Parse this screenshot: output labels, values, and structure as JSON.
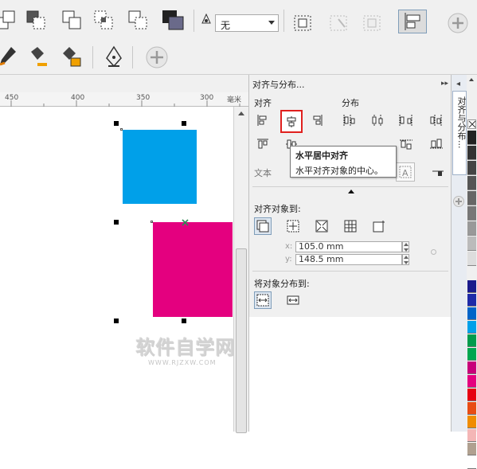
{
  "toolbar": {
    "font_option_value": "无",
    "add_label": "+"
  },
  "ruler": {
    "ticks": [
      "450",
      "400",
      "350",
      "300"
    ],
    "unit": "毫米"
  },
  "panel": {
    "title": "对齐与分布...",
    "align_label": "对齐",
    "distribute_label": "分布",
    "text_label": "文本",
    "align_to_label": "对齐对象到:",
    "distribute_to_label": "将对象分布到:",
    "x_prefix": "x:",
    "y_prefix": "y:",
    "x_value": "105.0 mm",
    "y_value": "148.5 mm"
  },
  "tooltip": {
    "title": "水平居中对齐",
    "description": "水平对齐对象的中心。"
  },
  "side_tab": {
    "label": "对齐与分布..."
  },
  "watermark": {
    "text": "软件自学网",
    "url": "WWW.RJZXW.COM"
  },
  "colors": {
    "blue_square": "#00a0e9",
    "magenta_square": "#e4007f",
    "highlight_border": "#e0201e",
    "palette": [
      "#1a1a8c",
      "#1e2aa8",
      "#0064c8",
      "#00a0e9",
      "#009b4c",
      "#00a650",
      "#c8007a",
      "#e4007f",
      "#e60012",
      "#e84c15",
      "#f08c00",
      "#f4b6b6",
      "#b0a090",
      "#ffffff"
    ]
  }
}
